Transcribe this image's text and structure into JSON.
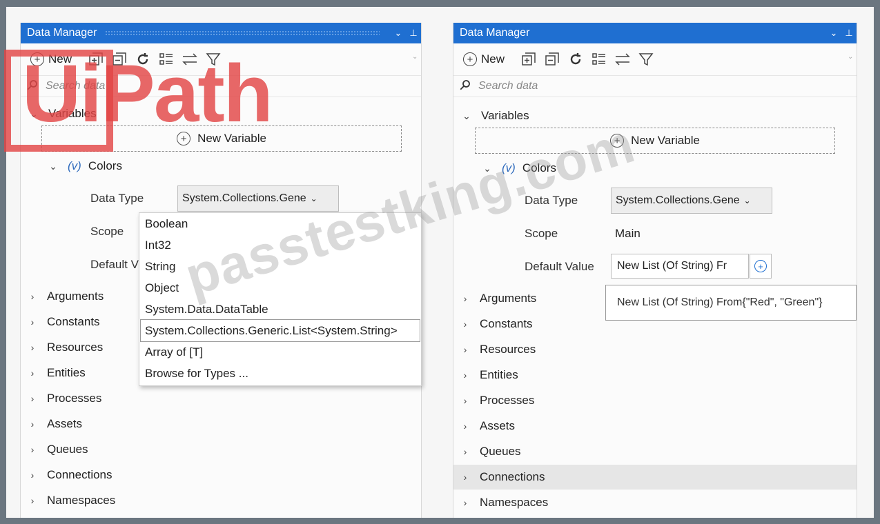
{
  "left_panel": {
    "title": "Data Manager",
    "title_buttons": [
      "⌄",
      "⊥"
    ],
    "new_label": "New",
    "search_placeholder": "Search data",
    "variables_label": "Variables",
    "new_variable_label": "New Variable",
    "variable": {
      "type_glyph": "(v)",
      "name": "Colors"
    },
    "data_type_label": "Data Type",
    "data_type_value": "System.Collections.Gene",
    "scope_label": "Scope",
    "default_label": "Default V",
    "dropdown_options": [
      "Boolean",
      "Int32",
      "String",
      "Object",
      "System.Data.DataTable",
      "System.Collections.Generic.List<System.String>",
      "Array of [T]",
      "Browse for Types ..."
    ],
    "dropdown_selected_index": 5,
    "categories": [
      "Arguments",
      "Constants",
      "Resources",
      "Entities",
      "Processes",
      "Assets",
      "Queues",
      "Connections",
      "Namespaces"
    ]
  },
  "right_panel": {
    "title": "Data Manager",
    "title_buttons": [
      "⌄",
      "⊥"
    ],
    "new_label": "New",
    "search_placeholder": "Search data",
    "variables_label": "Variables",
    "new_variable_label": "New Variable",
    "variable": {
      "type_glyph": "(v)",
      "name": "Colors"
    },
    "data_type_label": "Data Type",
    "data_type_value": "System.Collections.Gene",
    "scope_label": "Scope",
    "scope_value": "Main",
    "default_label": "Default Value",
    "default_value": "New List (Of String) Fr",
    "tooltip": "New List (Of String) From{\"Red\", \"Green\"}",
    "categories": [
      "Arguments",
      "Constants",
      "Resources",
      "Entities",
      "Processes",
      "Assets",
      "Queues",
      "Connections",
      "Namespaces"
    ],
    "highlighted_category": "Connections"
  },
  "watermarks": {
    "logo": "UiPath",
    "site": "passtestking.com"
  },
  "colors": {
    "titlebar": "#1f6fd1",
    "frame": "#6b7680",
    "logo_watermark": "#e24646"
  },
  "icons": [
    "new-plus-icon",
    "expand-all-icon",
    "collapse-all-icon",
    "refresh-icon",
    "list-view-icon",
    "swap-icon",
    "filter-icon",
    "search-icon",
    "chevron-down-icon",
    "chevron-right-icon",
    "pin-icon"
  ]
}
